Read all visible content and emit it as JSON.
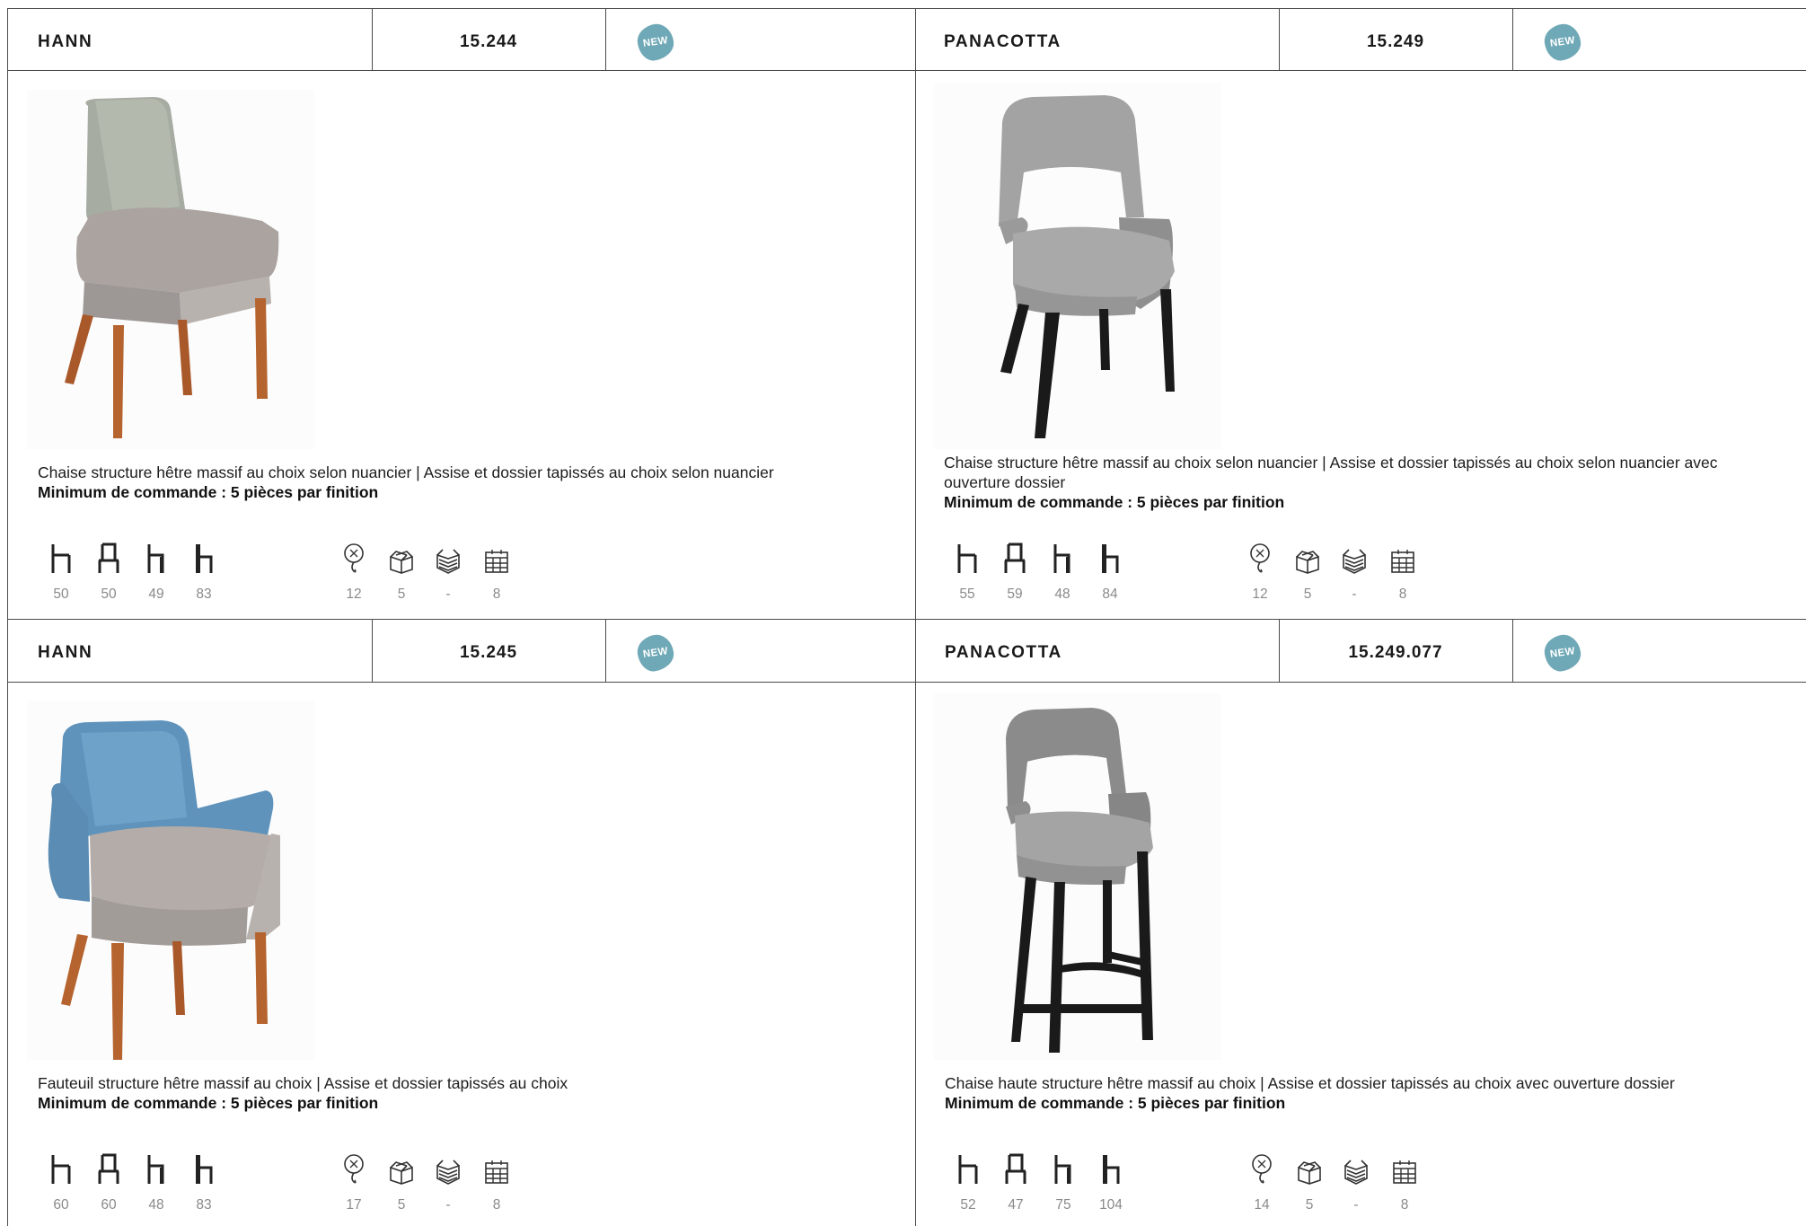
{
  "badge_label": "NEW",
  "colors": {
    "badge": "#6fa8b6",
    "rule": "#4a4a4a",
    "value_text": "#8a8a8a"
  },
  "products": [
    {
      "name": "HANN",
      "code": "15.244",
      "description": "Chaise structure hêtre massif au choix selon nuancier | Assise et dossier tapissés au choix selon nuancier",
      "min_order": "Minimum de commande : 5 pièces par finition",
      "dimensions": [
        "50",
        "50",
        "49",
        "83"
      ],
      "logistics": [
        "12",
        "5",
        "-",
        "8"
      ]
    },
    {
      "name": "PANACOTTA",
      "code": "15.249",
      "description": "Chaise structure hêtre massif au choix selon nuancier | Assise et dossier tapissés au choix selon nuancier avec ouverture dossier",
      "min_order": "Minimum de commande : 5 pièces par finition",
      "dimensions": [
        "55",
        "59",
        "48",
        "84"
      ],
      "logistics": [
        "12",
        "5",
        "-",
        "8"
      ]
    },
    {
      "name": "HANN",
      "code": "15.245",
      "description": "Fauteuil structure hêtre massif au choix | Assise et dossier tapissés au choix",
      "min_order": "Minimum de commande : 5 pièces par finition",
      "dimensions": [
        "60",
        "60",
        "48",
        "83"
      ],
      "logistics": [
        "17",
        "5",
        "-",
        "8"
      ]
    },
    {
      "name": "PANACOTTA",
      "code": "15.249.077",
      "description": "Chaise haute structure hêtre massif au choix | Assise et dossier tapissés au choix avec ouverture dossier",
      "min_order": "Minimum de commande : 5 pièces par finition",
      "dimensions": [
        "52",
        "47",
        "75",
        "104"
      ],
      "logistics": [
        "14",
        "5",
        "-",
        "8"
      ]
    }
  ],
  "dimension_icons": [
    "seat-width-icon",
    "seat-depth-icon",
    "seat-height-icon",
    "total-height-icon"
  ],
  "logistic_icons": [
    "weight-icon",
    "box-icon",
    "stack-icon",
    "pallet-icon"
  ]
}
